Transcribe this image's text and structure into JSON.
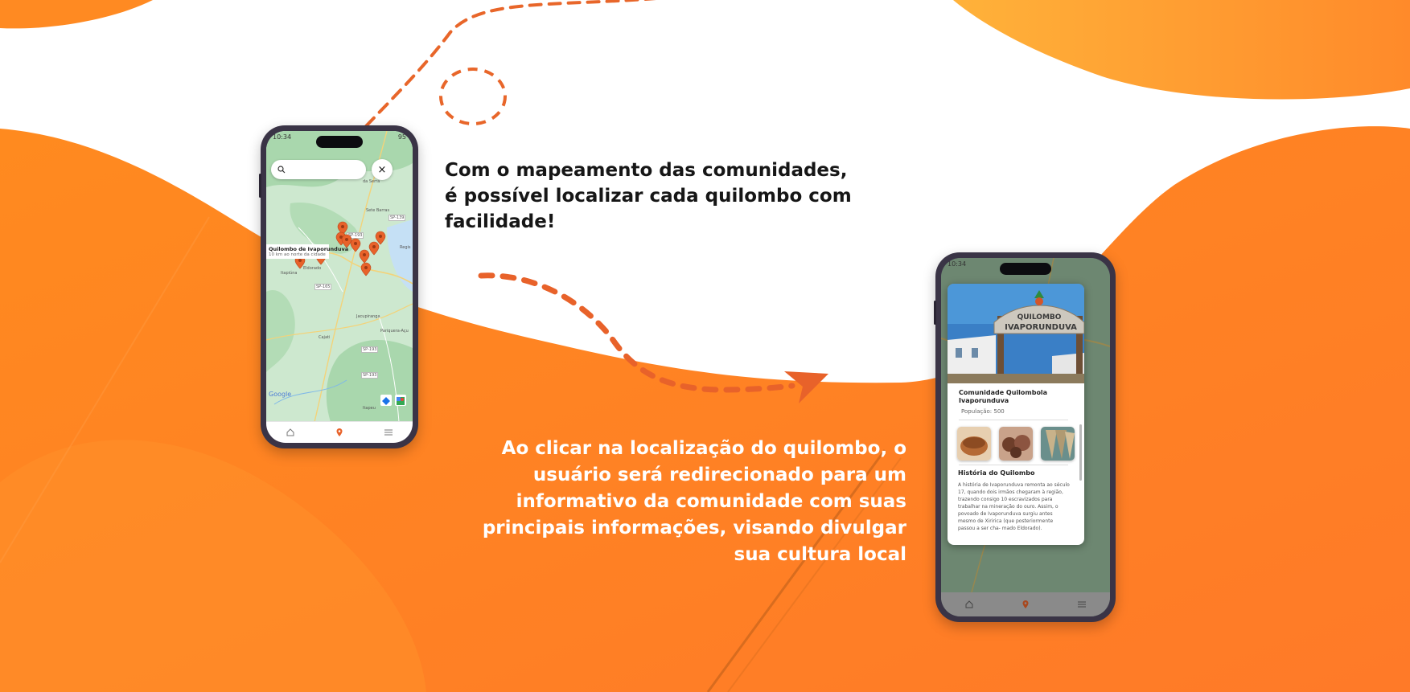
{
  "colors": {
    "accent_orange": "#ff7f24",
    "pin_orange": "#e8622a",
    "map_green": "#c8e6c9",
    "phone_frame": "#3a3446"
  },
  "captions": {
    "map_feature": "Com o mapeamento das comunidades,\né possível localizar cada quilombo com\nfacilidade!",
    "detail_feature": "Ao clicar na localização do quilombo, o\nusuário será redirecionado para um\ninformativo da comunidade com suas\nprincipais informações, visando divulgar\nsua cultura local"
  },
  "phone_map": {
    "status_time": "10:34",
    "status_battery": "95",
    "search_icon": "search-icon",
    "close_label": "×",
    "place_labels": {
      "serra": "da Serra",
      "sete_barras": "Sete Barras",
      "registro": "Regis",
      "eldorado": "Eldorado",
      "jacupiranga": "Jacupiranga",
      "cajati": "Cajati",
      "pariquera": "Pariquera-Açu",
      "itapirapua": "Itapiúna",
      "barra_turvo": "Itapeu",
      "road1": "SP-193",
      "road2": "SP-139",
      "road3": "SP-165",
      "road4": "SP-193",
      "road5": "SP-193"
    },
    "tooltip_title": "Quilombo de Ivaporunduva",
    "tooltip_subtitle": "10 km ao norte da cidade",
    "google_label": "Google",
    "nav_icons": [
      "home-icon",
      "location-pin-icon",
      "menu-icon"
    ]
  },
  "phone_detail": {
    "status_time": "10:34",
    "sign_text_top": "QUILOMBO",
    "sign_text_bottom": "IVAPORUNDUVA",
    "title": "Comunidade Quilombola Ivaporunduva",
    "population": "População: 500",
    "history_title": "História do Quilombo",
    "history_text": "A história de Ivaporunduva remonta ao século\n17, quando  dois irmãos chegaram à região,\ntrazendo consigo 10 escravizados para\ntrabalhar na mineração do ouro. Assim, o\npovoado de Ivaporunduva surgiu antes\nmesmo de Xiririca (que posteriormente\npassou a ser cha- mado Eldorado).",
    "thumbnails": [
      "basket-thumbnail",
      "pottery-thumbnail",
      "straw-craft-thumbnail"
    ],
    "nav_icons": [
      "home-icon",
      "location-pin-icon",
      "menu-icon"
    ]
  }
}
